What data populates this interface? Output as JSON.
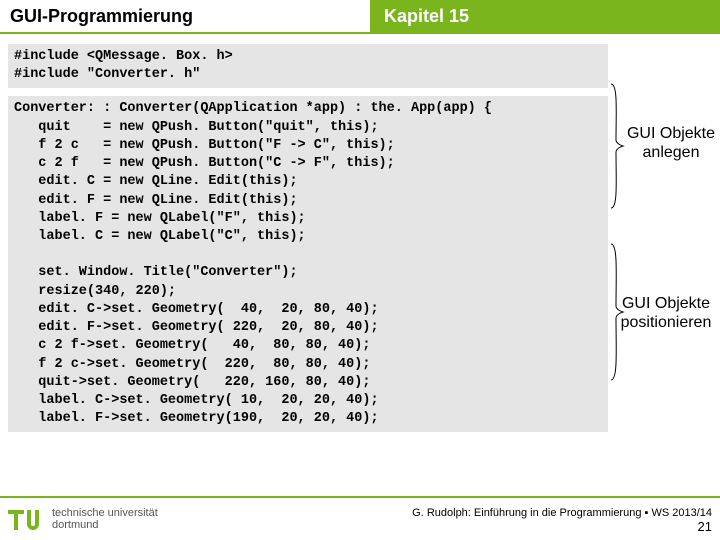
{
  "header": {
    "left": "GUI-Programmierung",
    "right": "Kapitel 15"
  },
  "code": {
    "includes": "#include <QMessage. Box. h>\n#include \"Converter. h\"",
    "ctor": "Converter: : Converter(QApplication *app) : the. App(app) {\n   quit    = new QPush. Button(\"quit\", this);\n   f 2 c   = new QPush. Button(\"F -> C\", this);\n   c 2 f   = new QPush. Button(\"C -> F\", this);\n   edit. C = new QLine. Edit(this);\n   edit. F = new QLine. Edit(this);\n   label. F = new QLabel(\"F\", this);\n   label. C = new QLabel(\"C\", this);\n\n   set. Window. Title(\"Converter\");\n   resize(340, 220);\n   edit. C->set. Geometry(  40,  20, 80, 40);\n   edit. F->set. Geometry( 220,  20, 80, 40);\n   c 2 f->set. Geometry(   40,  80, 80, 40);\n   f 2 c->set. Geometry(  220,  80, 80, 40);\n   quit->set. Geometry(   220, 160, 80, 40);\n   label. C->set. Geometry( 10,  20, 20, 40);\n   label. F->set. Geometry(190,  20, 20, 40);"
  },
  "annot": {
    "a1_l1": "GUI Objekte",
    "a1_l2": "anlegen",
    "a2_l1": "GUI Objekte",
    "a2_l2": "positionieren"
  },
  "footer": {
    "uni1": "technische universität",
    "uni2": "dortmund",
    "credit": "G. Rudolph: Einführung in die Programmierung ▪ WS 2013/14",
    "page": "21"
  }
}
